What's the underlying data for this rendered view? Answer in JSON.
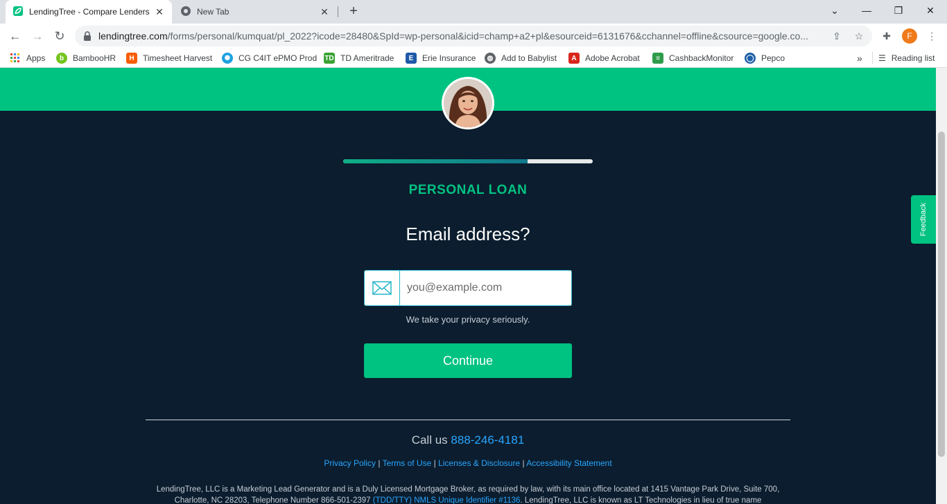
{
  "browser": {
    "tabs": [
      {
        "title": "LendingTree - Compare Lenders",
        "active": true
      },
      {
        "title": "New Tab",
        "active": false
      }
    ],
    "url": {
      "host": "lendingtree.com",
      "path": "/forms/personal/kumquat/pl_2022?icode=28480&SpId=wp-personal&icid=champ+a2+pl&esourceid=6131676&cchannel=offline&csource=google.co..."
    },
    "profile_initial": "F",
    "bookmarks": [
      {
        "label": "Apps",
        "icon": "apps-grid-icon"
      },
      {
        "label": "BambooHR",
        "icon": "bamboohr-icon"
      },
      {
        "label": "Timesheet Harvest",
        "icon": "harvest-icon"
      },
      {
        "label": "CG C4IT ePMO Prod",
        "icon": "cg-icon"
      },
      {
        "label": "TD Ameritrade",
        "icon": "td-icon"
      },
      {
        "label": "Erie Insurance",
        "icon": "erie-icon"
      },
      {
        "label": "Add to Babylist",
        "icon": "globe-icon"
      },
      {
        "label": "Adobe Acrobat",
        "icon": "acrobat-icon"
      },
      {
        "label": "CashbackMonitor",
        "icon": "cashback-icon"
      },
      {
        "label": "Pepco",
        "icon": "pepco-icon"
      }
    ],
    "bookmarks_more": "»",
    "reading_list": "Reading list"
  },
  "form": {
    "progress": 0.74,
    "loan_type": "PERSONAL LOAN",
    "question": "Email address?",
    "email_placeholder": "you@example.com",
    "privacy_note": "We take your privacy seriously.",
    "continue_label": "Continue"
  },
  "footer": {
    "call_prefix": "Call us",
    "phone": "888-246-4181",
    "links": [
      "Privacy Policy",
      "Terms of Use",
      "Licenses & Disclosure",
      "Accessibility Statement"
    ],
    "link_separator": "|",
    "legal_text": "LendingTree, LLC is a Marketing Lead Generator and is a Duly Licensed Mortgage Broker, as required by law, with its main office located at 1415 Vantage Park Drive, Suite 700, Charlotte, NC 28203, Telephone Number 866-501-2397",
    "legal_link_1": "(TDD/TTY)",
    "legal_link_2": "NMLS Unique Identifier #1136",
    "legal_text_2": ". LendingTree, LLC is known as LT Technologies in lieu of true name"
  },
  "feedback_label": "Feedback",
  "colors": {
    "brand_green": "#00c281",
    "page_bg": "#0b1d2e",
    "link_blue": "#2aa6ff"
  }
}
